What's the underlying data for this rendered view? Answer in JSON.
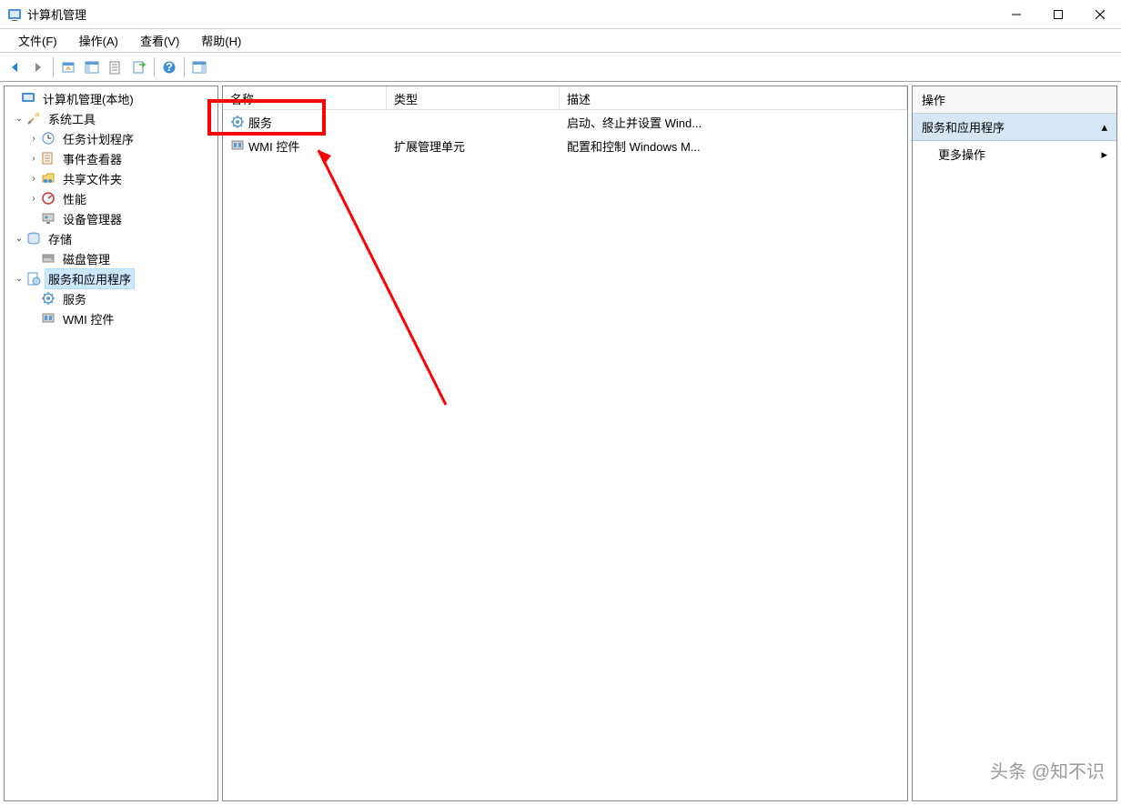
{
  "window": {
    "title": "计算机管理",
    "controls": {
      "minimize": "–",
      "maximize": "☐",
      "close": "✕"
    }
  },
  "menu": {
    "file": "文件(F)",
    "action": "操作(A)",
    "view": "查看(V)",
    "help": "帮助(H)"
  },
  "tree": {
    "root": "计算机管理(本地)",
    "system_tools": "系统工具",
    "task_scheduler": "任务计划程序",
    "event_viewer": "事件查看器",
    "shared_folders": "共享文件夹",
    "performance": "性能",
    "device_manager": "设备管理器",
    "storage": "存储",
    "disk_management": "磁盘管理",
    "services_apps": "服务和应用程序",
    "services": "服务",
    "wmi": "WMI 控件"
  },
  "list": {
    "headers": {
      "name": "名称",
      "type": "类型",
      "desc": "描述"
    },
    "rows": [
      {
        "name": "服务",
        "type": "",
        "desc": "启动、终止并设置 Wind..."
      },
      {
        "name": "WMI 控件",
        "type": "扩展管理单元",
        "desc": "配置和控制 Windows M..."
      }
    ]
  },
  "actions": {
    "header": "操作",
    "section": "服务和应用程序",
    "more": "更多操作"
  },
  "watermark": "头条 @知不识"
}
